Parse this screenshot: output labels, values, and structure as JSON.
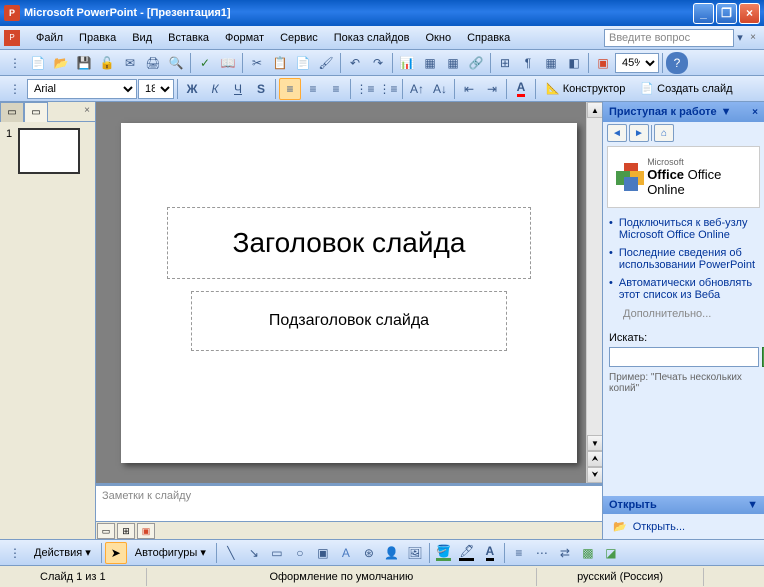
{
  "title": "Microsoft PowerPoint - [Презентация1]",
  "menu": {
    "file": "Файл",
    "edit": "Правка",
    "view": "Вид",
    "insert": "Вставка",
    "format": "Формат",
    "service": "Сервис",
    "show": "Показ слайдов",
    "window": "Окно",
    "help": "Справка"
  },
  "help_placeholder": "Введите вопрос",
  "font": {
    "name": "Arial",
    "size": "18"
  },
  "zoom": "45%",
  "format_btns": {
    "designer": "Конструктор",
    "new_slide": "Создать слайд"
  },
  "thumb_num": "1",
  "slide": {
    "title": "Заголовок слайда",
    "subtitle": "Подзаголовок слайда"
  },
  "notes_placeholder": "Заметки к слайду",
  "task": {
    "header": "Приступая к работе",
    "office_online": "Office Online",
    "office_prefix": "Microsoft",
    "links": [
      "Подключиться к веб-узлу Microsoft Office Online",
      "Последние сведения об использовании PowerPoint",
      "Автоматически обновлять этот список из Веба"
    ],
    "additional": "Дополнительно...",
    "search_label": "Искать:",
    "example_label": "Пример:",
    "example_text": "\"Печать нескольких копий\"",
    "open_header": "Открыть",
    "open_item": "Открыть..."
  },
  "draw": {
    "actions": "Действия",
    "autoshapes": "Автофигуры"
  },
  "status": {
    "slide": "Слайд 1 из 1",
    "design": "Оформление по умолчанию",
    "lang": "русский (Россия)"
  }
}
